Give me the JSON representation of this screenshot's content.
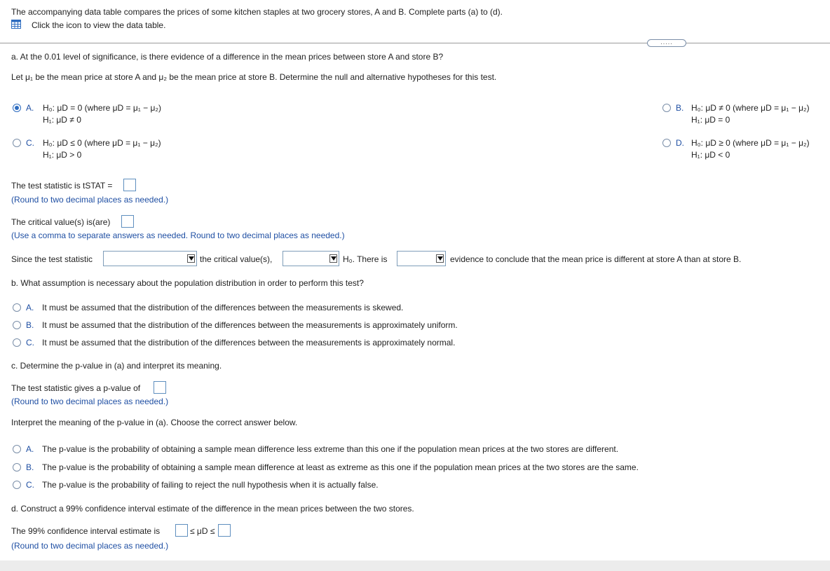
{
  "header": {
    "intro": "The accompanying data table compares the prices of some kitchen staples at two grocery stores, A and B. Complete parts (a) to (d).",
    "click_text": "Click the icon to view the data table.",
    "more_label": "....."
  },
  "part_a": {
    "question": "a. At the 0.01 level of significance, is there evidence of a difference in the mean prices between store A and store B?",
    "let_text": "Let μ₁ be the mean price at store A and μ₂ be the mean price at store B. Determine the null and alternative hypotheses for this test.",
    "options": [
      {
        "letter": "A.",
        "h0": "H₀: μD = 0 (where μD = μ₁ − μ₂)",
        "h1": "H₁: μD ≠ 0",
        "selected": true
      },
      {
        "letter": "B.",
        "h0": "H₀: μD ≠ 0 (where μD = μ₁ − μ₂)",
        "h1": "H₁: μD = 0",
        "selected": false
      },
      {
        "letter": "C.",
        "h0": "H₀: μD ≤ 0 (where μD = μ₁ − μ₂)",
        "h1": "H₁: μD > 0",
        "selected": false
      },
      {
        "letter": "D.",
        "h0": "H₀: μD ≥ 0 (where μD = μ₁ − μ₂)",
        "h1": "H₁: μD < 0",
        "selected": false
      }
    ],
    "tstat_label": "The test statistic is tSTAT =",
    "tstat_hint": "(Round to two decimal places as needed.)",
    "critical_label": "The critical value(s) is(are)",
    "critical_hint": "(Use a comma to separate answers as needed. Round to two decimal places as needed.)",
    "since_1": "Since the test statistic",
    "since_2": "the critical value(s),",
    "since_3": "H₀. There is",
    "since_4": "evidence to conclude that the mean price is different at store A than at store B."
  },
  "part_b": {
    "question": "b. What assumption is necessary about the population distribution in order to perform this test?",
    "options": [
      {
        "letter": "A.",
        "text": "It must be assumed that the distribution of the differences between the measurements is skewed."
      },
      {
        "letter": "B.",
        "text": "It must be assumed that the distribution of the differences between the measurements is approximately uniform."
      },
      {
        "letter": "C.",
        "text": "It must be assumed that the distribution of the differences between the measurements is approximately normal."
      }
    ]
  },
  "part_c": {
    "question": "c. Determine the p-value in (a) and interpret its meaning.",
    "pvalue_label": "The test statistic gives a p-value of",
    "pvalue_hint": "(Round to two decimal places as needed.)",
    "interpret": "Interpret the meaning of the p-value in (a). Choose the correct answer below.",
    "options": [
      {
        "letter": "A.",
        "text": "The p-value is the probability of obtaining a sample mean difference less extreme than this one if the population mean prices at the two stores are different."
      },
      {
        "letter": "B.",
        "text": "The p-value is the probability of obtaining a sample mean difference at least as extreme as this one if the population mean prices at the two stores are the same."
      },
      {
        "letter": "C.",
        "text": "The p-value is the probability of failing to reject the null hypothesis when it is actually false."
      }
    ]
  },
  "part_d": {
    "question": "d. Construct a 99% confidence interval estimate of the difference in the mean prices between the two stores.",
    "ci_label": "The 99% confidence interval estimate is",
    "ci_mid": "≤ μD ≤",
    "ci_hint": "(Round to two decimal places as needed.)"
  },
  "colors": {
    "accent": "#2d6cc0",
    "hint_text": "#1f4fa3",
    "footer": "#ececec"
  }
}
